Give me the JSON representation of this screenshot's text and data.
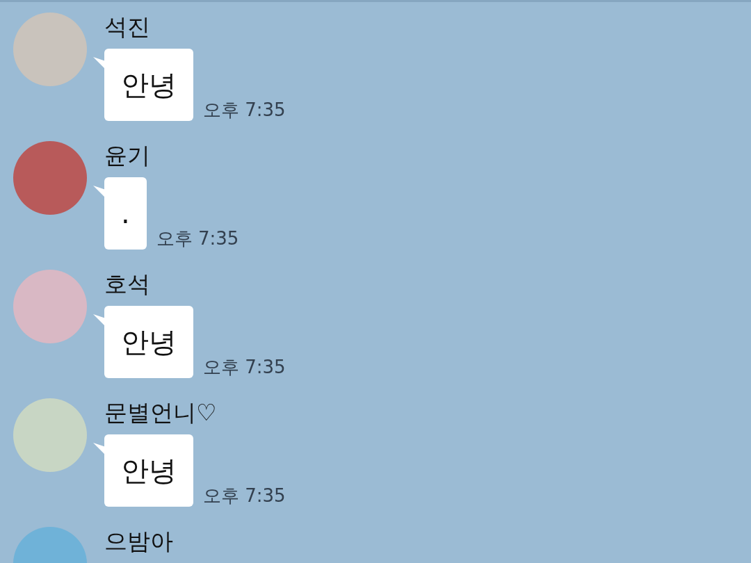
{
  "messages": [
    {
      "sender": "석진",
      "text": "안녕",
      "time": "오후 7:35"
    },
    {
      "sender": "윤기",
      "text": ".",
      "time": "오후 7:35"
    },
    {
      "sender": "호석",
      "text": "안녕",
      "time": "오후 7:35"
    },
    {
      "sender": "문별언니♡",
      "text": "안녕",
      "time": "오후 7:35"
    },
    {
      "sender": "으밤아"
    }
  ]
}
